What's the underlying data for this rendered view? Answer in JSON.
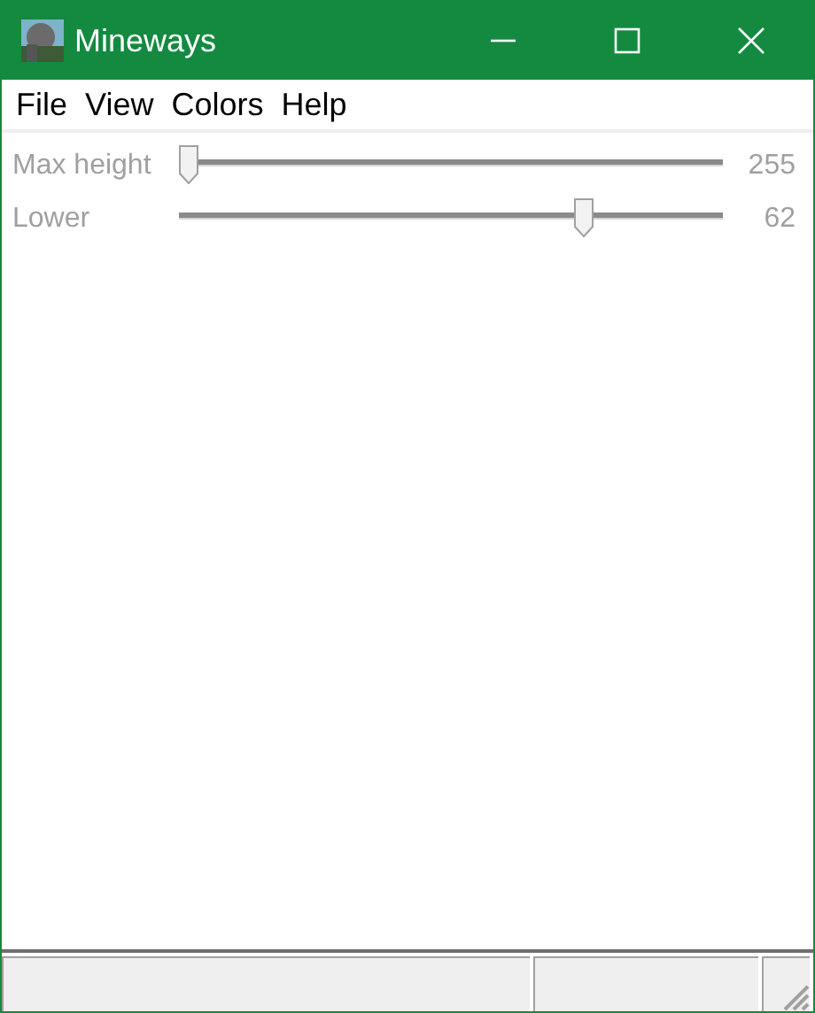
{
  "window": {
    "title": "Mineways"
  },
  "menu": [
    "File",
    "View",
    "Colors",
    "Help"
  ],
  "sliders": [
    {
      "label": "Max height",
      "level": 0,
      "reading": "255",
      "disabled": true
    },
    {
      "label": "Lower",
      "level": 0.755,
      "reading": "62",
      "disabled": true
    }
  ]
}
